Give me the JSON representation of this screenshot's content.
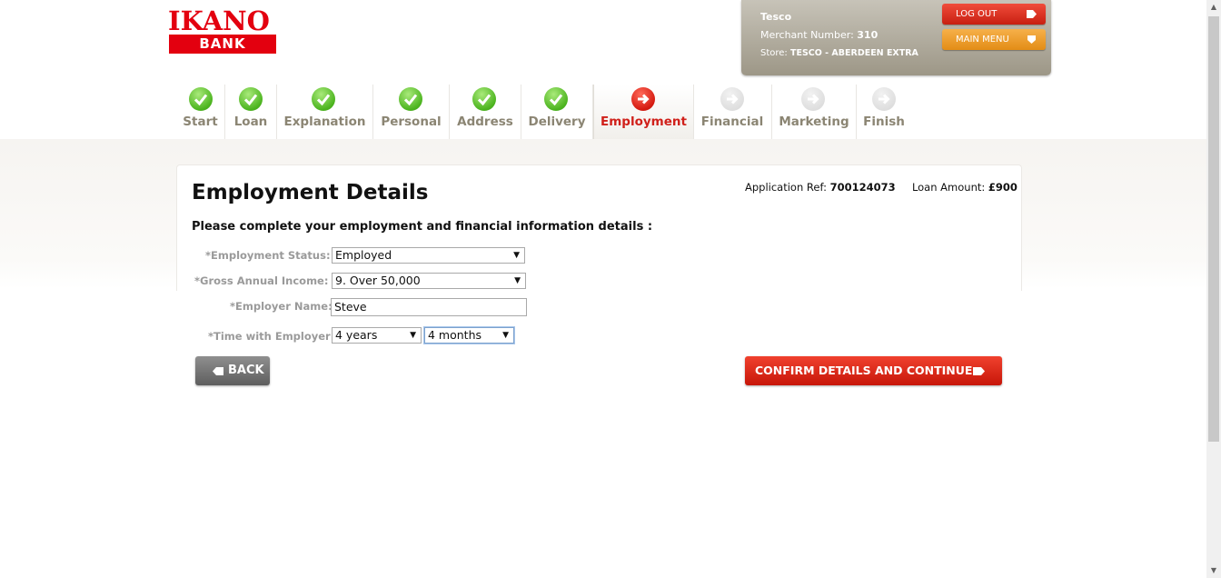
{
  "logo": {
    "top": "IKANO",
    "bottom": "BANK"
  },
  "merchant": {
    "name": "Tesco",
    "number_label": "Merchant Number:",
    "number": "310",
    "store_label": "Store:",
    "store": "TESCO - ABERDEEN EXTRA",
    "logout_label": "LOG OUT",
    "main_menu_label": "MAIN MENU"
  },
  "steps": [
    {
      "label": "Start",
      "state": "done"
    },
    {
      "label": "Loan",
      "state": "done"
    },
    {
      "label": "Explanation",
      "state": "done"
    },
    {
      "label": "Personal",
      "state": "done"
    },
    {
      "label": "Address",
      "state": "done"
    },
    {
      "label": "Delivery",
      "state": "done"
    },
    {
      "label": "Employment",
      "state": "current"
    },
    {
      "label": "Financial",
      "state": "todo"
    },
    {
      "label": "Marketing",
      "state": "todo"
    },
    {
      "label": "Finish",
      "state": "todo"
    }
  ],
  "page": {
    "title": "Employment Details",
    "app_ref_label": "Application Ref:",
    "app_ref": "700124073",
    "loan_amount_label": "Loan Amount:",
    "loan_amount": "£900",
    "subtitle": "Please complete your employment and financial information details :"
  },
  "form": {
    "employment_status_label": "*Employment Status:",
    "employment_status_value": "Employed",
    "gross_income_label": "*Gross Annual Income:",
    "gross_income_value": "9. Over 50,000",
    "employer_name_label": "*Employer Name:",
    "employer_name_value": "Steve",
    "time_label": "*Time with Employer:",
    "time_years_value": "4 years",
    "time_months_value": "4 months"
  },
  "buttons": {
    "back": "BACK",
    "confirm": "CONFIRM DETAILS AND CONTINUE"
  },
  "colors": {
    "brand_red": "#e3000f",
    "current_step": "#d0201a",
    "step_label": "#8b8573",
    "done_green": "#4cb41f",
    "main_menu_orange": "#e38d16"
  }
}
